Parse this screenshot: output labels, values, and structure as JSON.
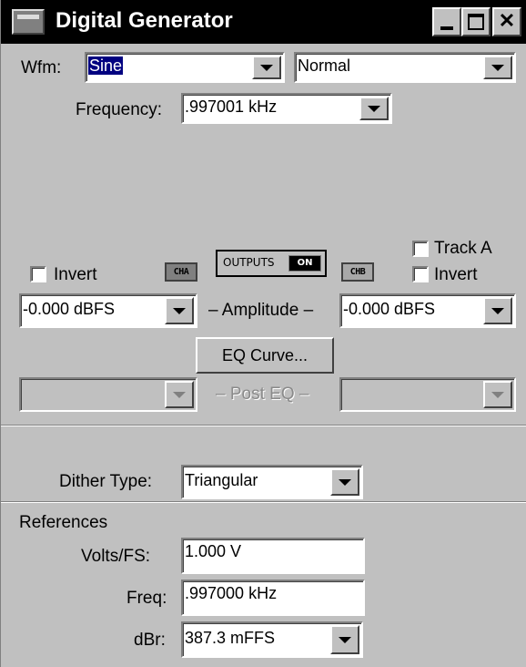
{
  "window": {
    "title": "Digital Generator"
  },
  "waveform": {
    "label": "Wfm:",
    "value": "Sine",
    "mode": "Normal"
  },
  "frequency": {
    "label": "Frequency:",
    "value": ".997001 kHz"
  },
  "outputs": {
    "cha": "CHA",
    "chb": "CHB",
    "outputs_label": "OUTPUTS",
    "on_label": "ON",
    "track_a_label": "Track A",
    "invert_a_label": "Invert",
    "invert_b_label": "Invert"
  },
  "amplitude": {
    "label": "– Amplitude –",
    "cha_value": "-0.000  dBFS",
    "chb_value": "-0.000  dBFS"
  },
  "eq": {
    "button_label": "EQ Curve...",
    "post_eq_label": "– Post EQ –",
    "cha_value": "",
    "chb_value": ""
  },
  "dither": {
    "label": "Dither Type:",
    "value": "Triangular"
  },
  "references": {
    "heading": "References",
    "volts_fs_label": "Volts/FS:",
    "volts_fs_value": "1.000   V",
    "freq_label": "Freq:",
    "freq_value": ".997000 kHz",
    "dbr_label": "dBr:",
    "dbr_value": "387.3  mFFS"
  }
}
